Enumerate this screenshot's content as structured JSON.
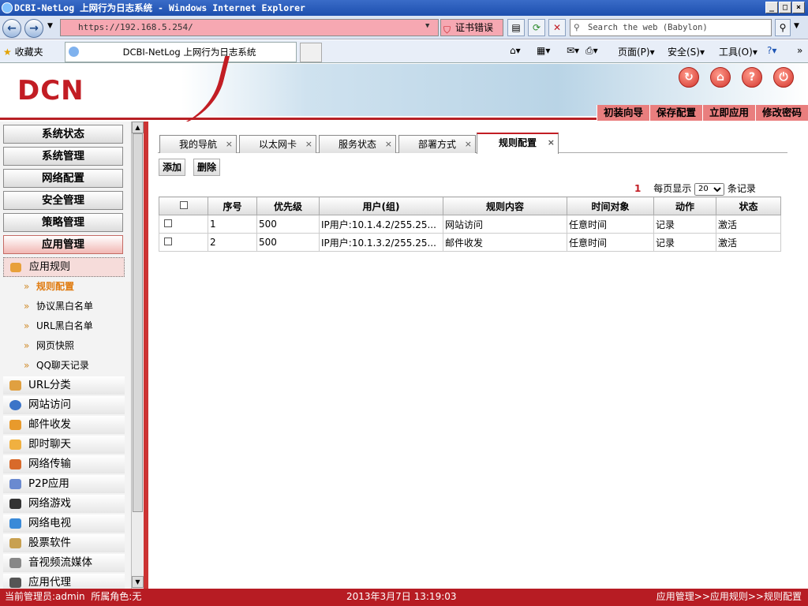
{
  "browser": {
    "window_title": "DCBI-NetLog 上网行为日志系统 - Windows Internet Explorer",
    "address": "https://192.168.5.254/",
    "cert_error": "证书错误",
    "search_placeholder": "Search the web (Babylon)",
    "favorites_label": "收藏夹",
    "tab_title": "DCBI-NetLog 上网行为日志系统",
    "commands": [
      "页面(P)",
      "安全(S)",
      "工具(O)"
    ]
  },
  "header": {
    "logo": "DCN",
    "menu": [
      "初装向导",
      "保存配置",
      "立即应用",
      "修改密码"
    ]
  },
  "sidebar": {
    "groups": [
      "系统状态",
      "系统管理",
      "网络配置",
      "安全管理",
      "策略管理",
      "应用管理"
    ],
    "active_section": "应用规则",
    "leaves": [
      "规则配置",
      "协议黑白名单",
      "URL黑白名单",
      "网页快照",
      "QQ聊天记录"
    ],
    "categories": [
      "URL分类",
      "网站访问",
      "邮件收发",
      "即时聊天",
      "网络传输",
      "P2P应用",
      "网络游戏",
      "网络电视",
      "股票软件",
      "音视频流媒体",
      "应用代理"
    ]
  },
  "main": {
    "tabs": [
      "我的导航",
      "以太网卡",
      "服务状态",
      "部署方式",
      "规则配置"
    ],
    "add_label": "添加",
    "delete_label": "删除",
    "pager": {
      "page": "1",
      "per_page_label": "每页显示",
      "per_page_value": "20",
      "records_label": "条记录"
    },
    "columns": [
      "序号",
      "优先级",
      "用户(组)",
      "规则内容",
      "时间对象",
      "动作",
      "状态"
    ],
    "rows": [
      [
        "1",
        "500",
        "IP用户:10.1.4.2/255.25...",
        "网站访问",
        "任意时间",
        "记录",
        "激活"
      ],
      [
        "2",
        "500",
        "IP用户:10.1.3.2/255.25...",
        "邮件收发",
        "任意时间",
        "记录",
        "激活"
      ]
    ]
  },
  "statusbar": {
    "admin": "当前管理员:admin  所属角色:无",
    "datetime": "2013年3月7日 13:19:03",
    "breadcrumb": "应用管理>>应用规则>>规则配置"
  }
}
